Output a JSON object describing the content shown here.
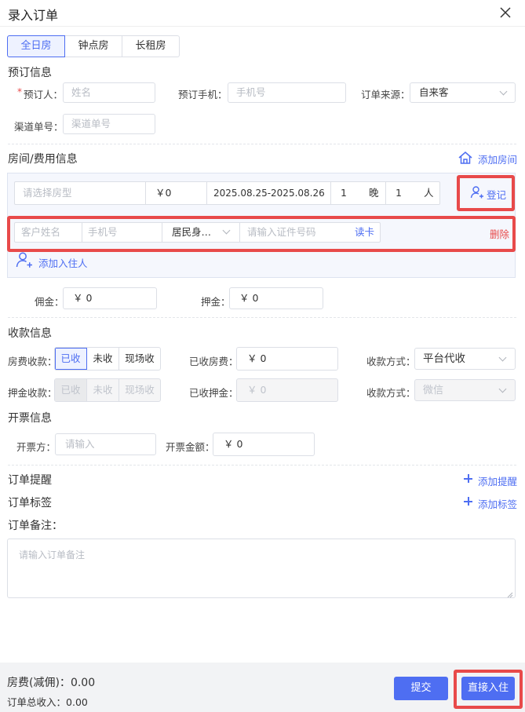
{
  "dialog": {
    "title": "录入订单"
  },
  "tabs": [
    {
      "label": "全日房",
      "active": true
    },
    {
      "label": "钟点房"
    },
    {
      "label": "长租房"
    }
  ],
  "booking": {
    "section_title": "预订信息",
    "required_mark": "*",
    "booker_label": "预订人：",
    "booker_placeholder": "姓名",
    "phone_label": "预订手机：",
    "phone_placeholder": "手机号",
    "source_label": "订单来源：",
    "source_value": "自来客",
    "channel_label": "渠道单号：",
    "channel_placeholder": "渠道单号"
  },
  "room": {
    "section_title": "房间/费用信息",
    "add_room": "添加房间",
    "room_type_placeholder": "请选择房型",
    "price": "￥0",
    "dates": "2025.08.25-2025.08.26",
    "nights": "1",
    "nights_unit": "晚",
    "persons": "1",
    "persons_unit": "人",
    "register": "登记",
    "guest_name_placeholder": "客户姓名",
    "guest_phone_placeholder": "手机号",
    "id_type": "居民身…",
    "id_placeholder": "请输入证件号码",
    "read_card": "读卡",
    "delete": "删除",
    "add_guest": "添加入住人",
    "commission_label": "佣金：",
    "commission_value": "￥ 0",
    "deposit_label": "押金：",
    "deposit_value": "￥ 0"
  },
  "payment": {
    "section_title": "收款信息",
    "room_fee_label": "房费收款：",
    "room_fee_options": [
      "已收",
      "未收",
      "现场收"
    ],
    "received_room_label": "已收房费：",
    "received_room_value": "￥ 0",
    "method_label": "收款方式：",
    "method_value": "平台代收",
    "deposit_label": "押金收款：",
    "deposit_options": [
      "已收",
      "未收",
      "现场收"
    ],
    "received_deposit_label": "已收押金：",
    "received_deposit_value": "￥ 0",
    "method2_label": "收款方式：",
    "method2_value": "微信"
  },
  "invoice": {
    "section_title": "开票信息",
    "issuer_label": "开票方：",
    "issuer_placeholder": "请输入",
    "amount_label": "开票金额：",
    "amount_value": "￥ 0"
  },
  "reminder": {
    "title": "订单提醒",
    "add": "添加提醒"
  },
  "tag": {
    "title": "订单标签",
    "add": "添加标签"
  },
  "remark": {
    "title": "订单备注：",
    "placeholder": "请输入订单备注"
  },
  "footer": {
    "room_fee_label": "房费(减佣)：",
    "room_fee_value": "0.00",
    "total_label": "订单总收入：",
    "total_value": "0.00",
    "submit": "提交",
    "checkin": "直接入住"
  },
  "colors": {
    "accent": "#4e6ef2",
    "danger": "#e84a4a",
    "highlight": "#e84a4a"
  }
}
